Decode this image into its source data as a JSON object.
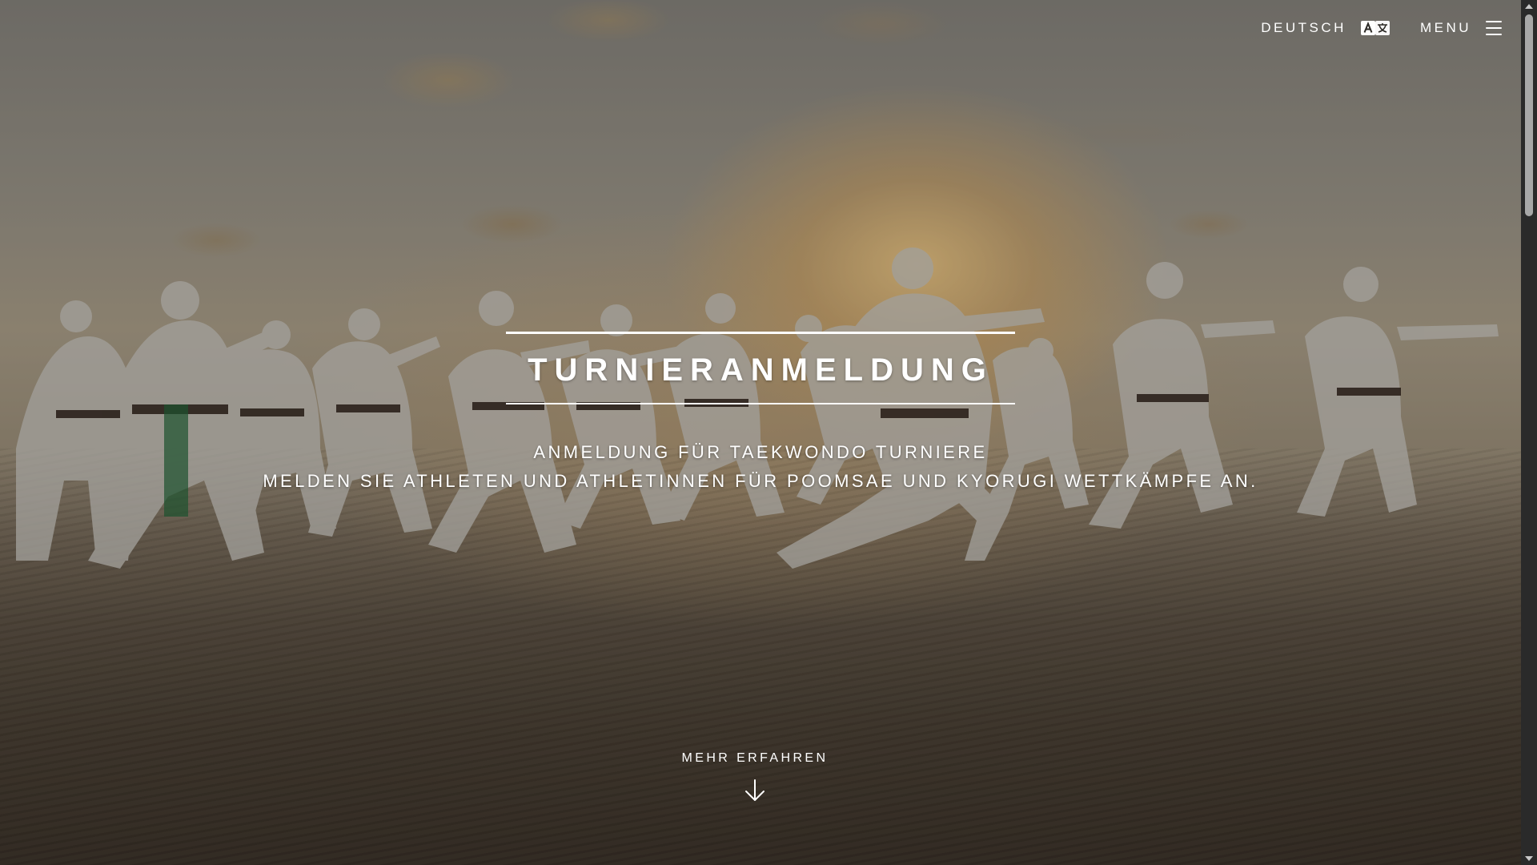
{
  "nav": {
    "language_label": "DEUTSCH",
    "language_icon": "translate-icon",
    "menu_label": "MENU",
    "menu_icon": "hamburger-icon"
  },
  "hero": {
    "title": "TURNIERANMELDUNG",
    "subtitle_line1": "ANMELDUNG FÜR TAEKWONDO TURNIERE",
    "subtitle_line2": "MELDEN SIE ATHLETEN UND ATHLETINNEN FÜR POOMSAE UND KYORUGI WETTKÄMPFE AN.",
    "background_image": "taekwondo athletes training on beach at sunset"
  },
  "learn_more": {
    "label": "MEHR ERFAHREN",
    "icon": "arrow-down-icon"
  },
  "colors": {
    "text": "#ffffff",
    "scrollbar_track": "#2a2a2a",
    "scrollbar_thumb": "#a8a8a8"
  }
}
